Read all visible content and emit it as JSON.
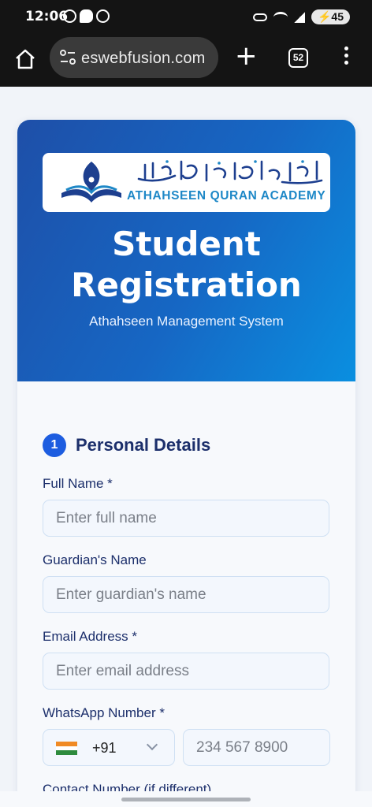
{
  "status_bar": {
    "time": "12:06",
    "notifications": [
      "whatsapp-icon",
      "chat-icon",
      "whatsapp-icon"
    ],
    "battery": "45"
  },
  "browser": {
    "url": "eswebfusion.com",
    "tab_count": "52"
  },
  "header": {
    "logo_text": "ATHAHSEEN QURAN ACADEMY",
    "title": "Student Registration",
    "subtitle": "Athahseen Management System",
    "gradient_colors": [
      "#1e4fa8",
      "#0a8fe0"
    ]
  },
  "form": {
    "section": {
      "number": "1",
      "title": "Personal Details"
    },
    "fields": {
      "full_name": {
        "label": "Full Name *",
        "placeholder": "Enter full name"
      },
      "guardian_name": {
        "label": "Guardian's Name",
        "placeholder": "Enter guardian's name"
      },
      "email": {
        "label": "Email Address *",
        "placeholder": "Enter email address"
      },
      "whatsapp": {
        "label": "WhatsApp Number *",
        "country_code": "+91",
        "placeholder": "234 567 8900"
      },
      "contact": {
        "label": "Contact Number (if different)"
      }
    }
  },
  "colors": {
    "accent": "#1d5de0",
    "label": "#1c2f6b",
    "logo_text": "#1e88c7"
  }
}
